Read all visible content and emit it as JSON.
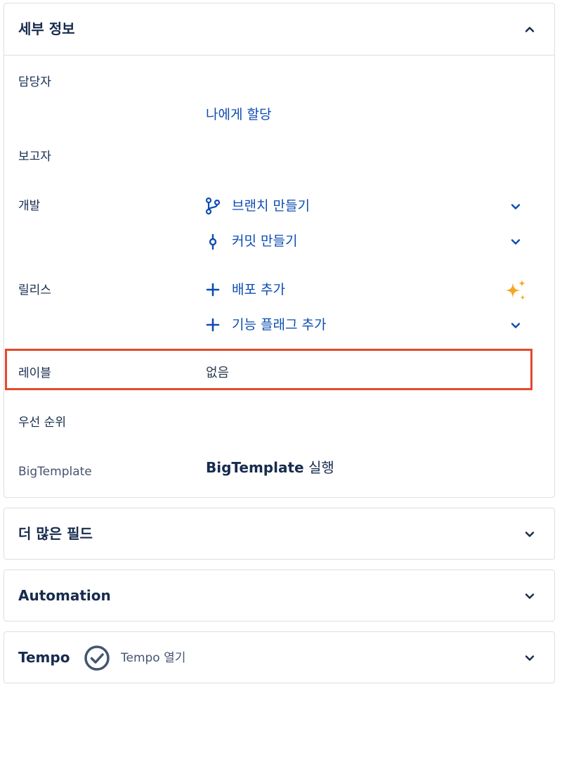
{
  "details": {
    "title": "세부 정보",
    "assignee_label": "담당자",
    "assign_to_me": "나에게 할당",
    "reporter_label": "보고자",
    "development_label": "개발",
    "create_branch": "브랜치 만들기",
    "create_commit": "커밋 만들기",
    "releases_label": "릴리스",
    "add_deployment": "배포 추가",
    "add_feature_flag": "기능 플래그 추가",
    "labels_label": "레이블",
    "labels_value": "없음",
    "priority_label": "우선 순위",
    "bigtemplate_label": "BigTemplate",
    "bigtemplate_value_bold": "BigTemplate",
    "bigtemplate_value_rest": " 실행"
  },
  "more_fields": {
    "title": "더 많은 필드"
  },
  "automation": {
    "title": "Automation"
  },
  "tempo": {
    "title": "Tempo",
    "open_label": "Tempo 열기"
  },
  "colors": {
    "link": "#0c4db3",
    "text": "#172b4d",
    "highlight": "#e34a2c",
    "sparkle": "#f5a623"
  }
}
